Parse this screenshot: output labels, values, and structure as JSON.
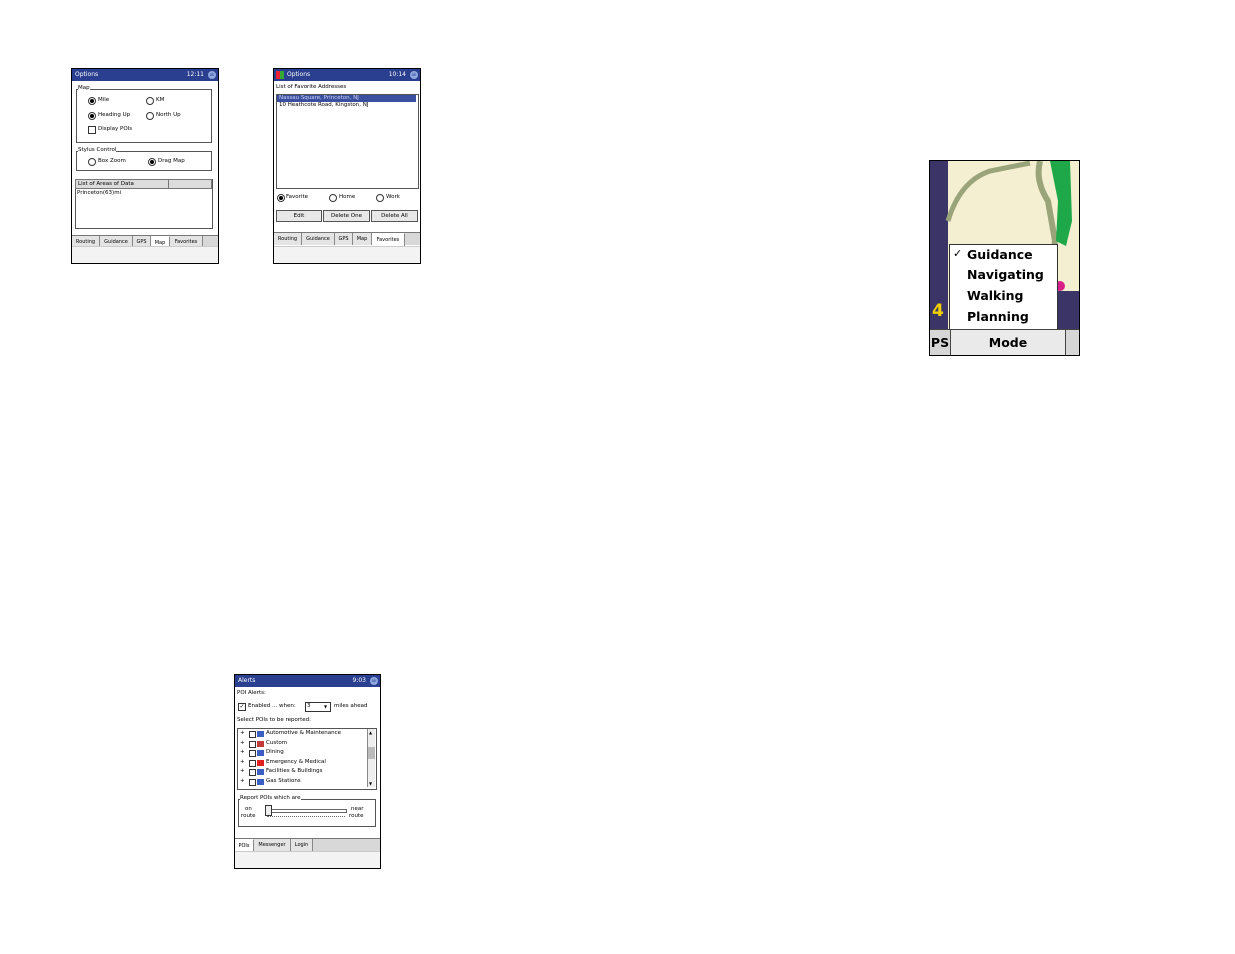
{
  "screen_options_map": {
    "title": "Options",
    "time": "12:11",
    "ok": "ok",
    "group_label": "Map",
    "radio_miles": "Mile",
    "radio_km": "KM",
    "radio_heading_up": "Heading Up",
    "radio_north_up": "North Up",
    "check_display_pois": "Display POIs",
    "stylus_group_label": "Stylus Control",
    "radio_box_zoom": "Box Zoom",
    "radio_drag_map": "Drag Map",
    "list_header": "List of Areas of Data",
    "list_item": "Princeton(63)mi",
    "tabs": [
      "Routing",
      "Guidance",
      "GPS",
      "Map",
      "Favorites"
    ]
  },
  "screen_favorites": {
    "title": "Options",
    "time": "10:14",
    "ok": "ok",
    "list_label": "List of Favorite Addresses",
    "items": [
      "Nassau Square, Princeton, NJ",
      "10 Heathcote Road, Kingston, NJ"
    ],
    "radio_favorite": "Favorite",
    "radio_home": "Home",
    "radio_work": "Work",
    "btn_edit": "Edit",
    "btn_delete_one": "Delete One",
    "btn_delete_all": "Delete All",
    "tabs": [
      "Routing",
      "Guidance",
      "GPS",
      "Map",
      "Favorites"
    ]
  },
  "screen_alerts": {
    "title": "Alerts",
    "time": "9:03",
    "ok": "ok",
    "poi_alerts_label": "POI Alerts:",
    "enabled_label": "Enabled ... when:",
    "miles_value": "3",
    "miles_ahead": "miles ahead",
    "select_label": "Select POIs to be reported:",
    "poi_items": [
      "Automotive & Maintenance",
      "Custom",
      "Dining",
      "Emergency & Medical",
      "Facilities & Buildings",
      "Gas Stations"
    ],
    "report_group_label": "Report POIs which are",
    "on_route_top": "on",
    "on_route_bottom": "route",
    "near_route_top": "near",
    "near_route_bottom": "route",
    "tabs": [
      "POIs",
      "Messenger",
      "Login"
    ]
  },
  "map_menu": {
    "items": [
      "Guidance",
      "Navigating",
      "Walking",
      "Planning"
    ],
    "checked": "Guidance",
    "left_digit": "4",
    "ps_label": "PS",
    "mode_label": "Mode (Guidance)",
    "colors": {
      "map_bg": "#f4efd0",
      "road": "#9aa47a",
      "green": "#1fa84a",
      "dark": "#3b3466",
      "magenta": "#d8208a",
      "digit": "#f0d000"
    }
  }
}
